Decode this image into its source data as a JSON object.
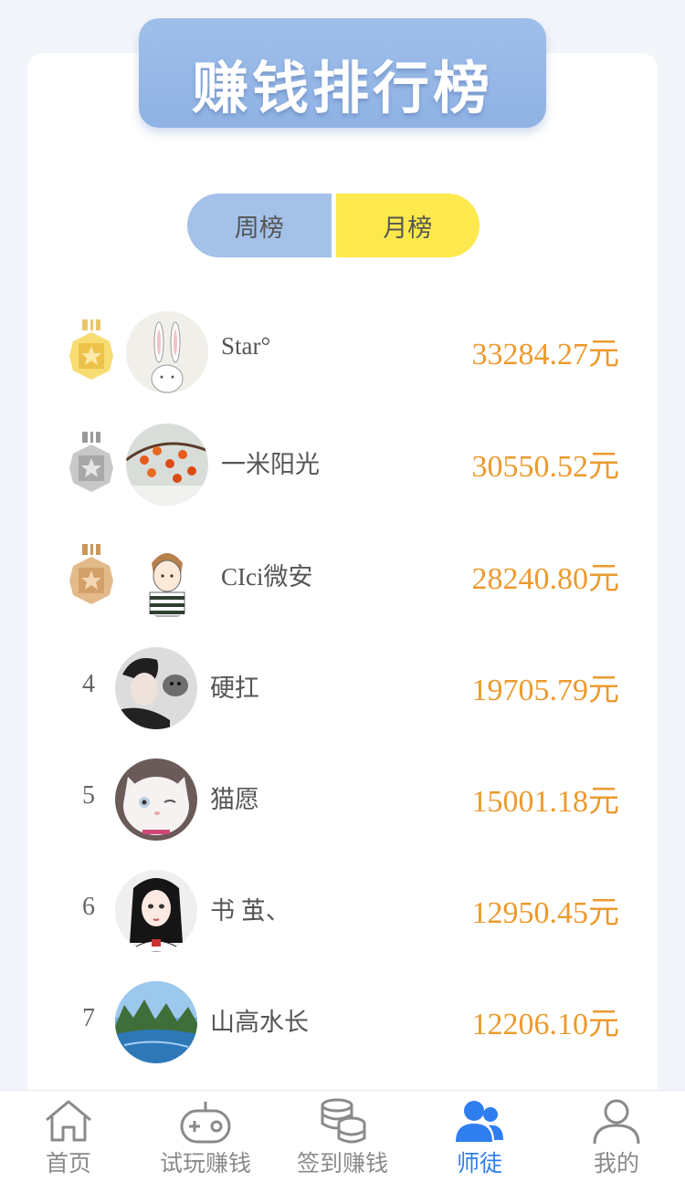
{
  "banner": {
    "title": "赚钱排行榜"
  },
  "tabs": [
    {
      "label": "周榜",
      "active": false
    },
    {
      "label": "月榜",
      "active": true
    }
  ],
  "ranking": [
    {
      "rank": "1",
      "name": "Star°",
      "amount": "33284.27元",
      "medal": "gold"
    },
    {
      "rank": "2",
      "name": "一米阳光",
      "amount": "30550.52元",
      "medal": "silver"
    },
    {
      "rank": "3",
      "name": "CIci微安",
      "amount": "28240.80元",
      "medal": "bronze"
    },
    {
      "rank": "4",
      "name": "硬扛",
      "amount": "19705.79元"
    },
    {
      "rank": "5",
      "name": "猫愿",
      "amount": "15001.18元"
    },
    {
      "rank": "6",
      "name": "书 茧、",
      "amount": "12950.45元"
    },
    {
      "rank": "7",
      "name": "山高水长",
      "amount": "12206.10元"
    }
  ],
  "nav": [
    {
      "label": "首页",
      "icon": "home-icon",
      "active": false
    },
    {
      "label": "试玩赚钱",
      "icon": "gamepad-icon",
      "active": false
    },
    {
      "label": "签到赚钱",
      "icon": "coins-icon",
      "active": false
    },
    {
      "label": "师徒",
      "icon": "users-icon",
      "active": true
    },
    {
      "label": "我的",
      "icon": "user-icon",
      "active": false
    }
  ],
  "colors": {
    "accent": "#2f7ef0",
    "amount": "#ec9a2e",
    "tab_active": "#fde94d",
    "tab_inactive": "#a4c1e8",
    "banner": "#9fbfea"
  }
}
